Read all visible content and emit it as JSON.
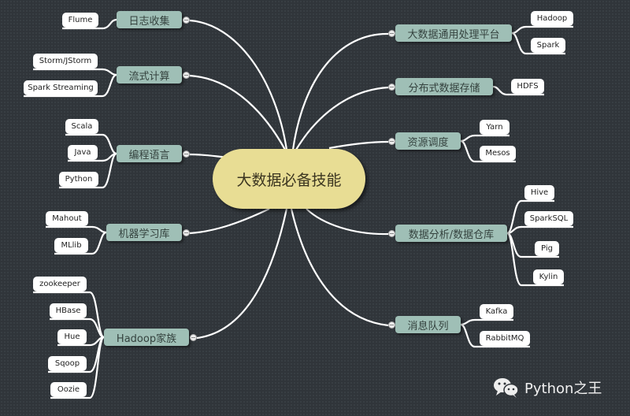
{
  "root": {
    "label": "大数据必备技能"
  },
  "left_topics": [
    {
      "label": "日志收集",
      "children": [
        "Flume"
      ]
    },
    {
      "label": "流式计算",
      "children": [
        "Storm/JStorm",
        "Spark Streaming"
      ]
    },
    {
      "label": "编程语言",
      "children": [
        "Scala",
        "Java",
        "Python"
      ]
    },
    {
      "label": "机器学习库",
      "children": [
        "Mahout",
        "MLlib"
      ]
    },
    {
      "label": "Hadoop家族",
      "children": [
        "zookeeper",
        "HBase",
        "Hue",
        "Sqoop",
        "Oozie"
      ]
    }
  ],
  "right_topics": [
    {
      "label": "大数据通用处理平台",
      "children": [
        "Hadoop",
        "Spark"
      ]
    },
    {
      "label": "分布式数据存储",
      "children": [
        "HDFS"
      ]
    },
    {
      "label": "资源调度",
      "children": [
        "Yarn",
        "Mesos"
      ]
    },
    {
      "label": "数据分析/数据仓库",
      "children": [
        "Hive",
        "SparkSQL",
        "Pig",
        "Kylin"
      ]
    },
    {
      "label": "消息队列",
      "children": [
        "Kafka",
        "RabbitMQ"
      ]
    }
  ],
  "watermark": {
    "text": "Python之王",
    "icon": "wechat-icon"
  }
}
